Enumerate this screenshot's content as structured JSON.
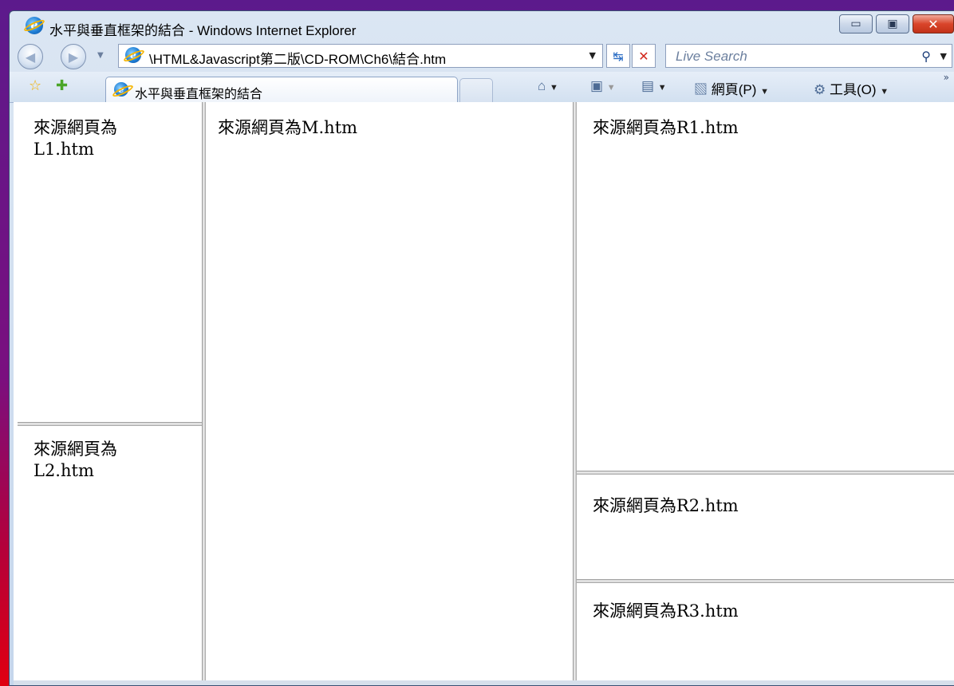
{
  "window": {
    "title": "水平與垂直框架的結合 - Windows Internet Explorer",
    "minimize_glyph": "▭",
    "maximize_glyph": "▣",
    "close_glyph": "✕"
  },
  "address_bar": {
    "url": "\\HTML&Javascript第二版\\CD-ROM\\Ch6\\結合.htm",
    "dropdown_glyph": "▼",
    "refresh_glyph": "↹",
    "stop_glyph": "✕"
  },
  "search": {
    "placeholder": "Live Search",
    "icon_glyph": "⚲",
    "dropdown_glyph": "▼"
  },
  "nav": {
    "back_glyph": "◀",
    "forward_glyph": "▶",
    "dropdown_glyph": "▼"
  },
  "tab": {
    "label": "水平與垂直框架的結合"
  },
  "command_bar": {
    "page_label": "網頁(P)",
    "tools_label": "工具(O)",
    "more_glyph": "»"
  },
  "icons": {
    "ie_logo": "e",
    "favorites_icon": "☆",
    "add_favorites_icon": "✚",
    "home_icon": "⌂",
    "feeds_icon": "▣",
    "print_icon": "▤",
    "page_icon": "▧",
    "tools_icon": "⚙",
    "dropdown_arrow": "▼"
  },
  "frames": {
    "l1": "來源網頁為L1.htm",
    "l2": "來源網頁為L2.htm",
    "m": "來源網頁為M.htm",
    "r1": "來源網頁為R1.htm",
    "r2": "來源網頁為R2.htm",
    "r3": "來源網頁為R3.htm"
  }
}
